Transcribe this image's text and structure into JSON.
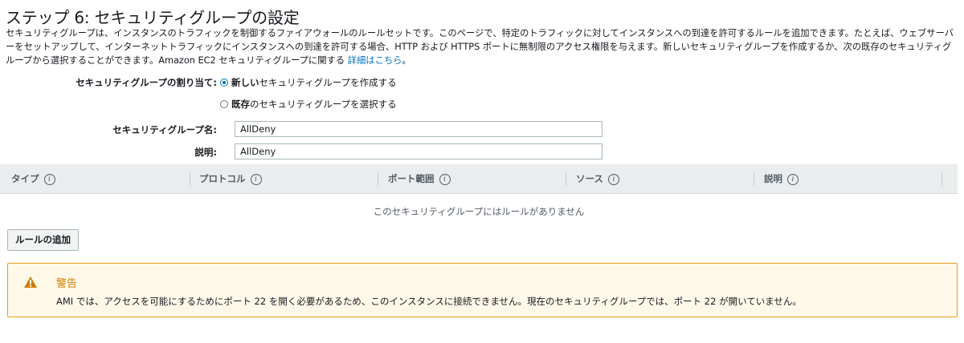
{
  "page": {
    "title": "ステップ 6: セキュリティグループの設定",
    "description_text": "セキュリティグループは、インスタンスのトラフィックを制御するファイアウォールのルールセットです。このページで、特定のトラフィックに対してインスタンスへの到達を許可するルールを追加できます。たとえば、ウェブサーバーをセットアップして、インターネットトラフィックにインスタンスへの到達を許可する場合、HTTP および HTTPS ポートに無制限のアクセス権限を与えます。新しいセキュリティグループを作成するか、次の既存のセキュリティグループから選択することができます。Amazon EC2 セキュリティグループに関する ",
    "description_link": "詳細はこちら",
    "description_end": "。"
  },
  "assign": {
    "label": "セキュリティグループの割り当て:",
    "option_new_bold": "新しい",
    "option_new_rest": "セキュリティグループを作成する",
    "option_existing_bold": "既存",
    "option_existing_rest": "のセキュリティグループを選択する",
    "selected": "new"
  },
  "fields": {
    "name_label": "セキュリティグループ名:",
    "name_value": "AllDeny",
    "desc_label": "説明:",
    "desc_value": "AllDeny"
  },
  "table": {
    "columns": [
      "タイプ",
      "プロトコル",
      "ポート範囲",
      "ソース",
      "説明"
    ],
    "info_glyph": "i",
    "empty_message": "このセキュリティグループにはルールがありません"
  },
  "buttons": {
    "add_rule": "ルールの追加"
  },
  "warning": {
    "title": "警告",
    "message": "AMI では、アクセスを可能にするためにポート 22 を開く必要があるため、このインスタンスに接続できません。現在のセキュリティグループでは、ポート 22 が開いていません。",
    "icon": "warning-triangle-icon",
    "colors": {
      "border": "#ec9d1c",
      "background": "#fef8e9",
      "title": "#d07c00"
    }
  },
  "colors": {
    "link": "#0073bb",
    "table_header": "#eaeded"
  }
}
